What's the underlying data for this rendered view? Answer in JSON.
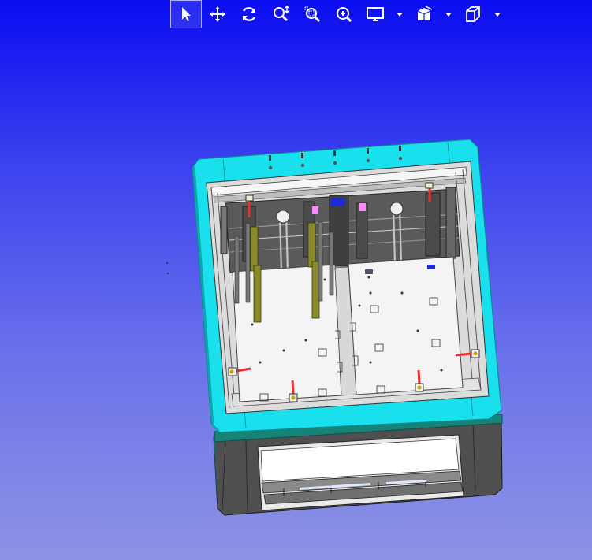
{
  "app": {
    "type": "cad-3d-viewer"
  },
  "toolbar": {
    "tools": [
      {
        "id": "select",
        "icon": "cursor-arrow-icon",
        "active": true
      },
      {
        "id": "pan",
        "icon": "pan-move-icon",
        "active": false
      },
      {
        "id": "rotate",
        "icon": "rotate-icon",
        "active": false
      },
      {
        "id": "zoom",
        "icon": "zoom-icon",
        "active": false
      },
      {
        "id": "zoom-window",
        "icon": "zoom-window-icon",
        "active": false
      },
      {
        "id": "zoom-fit",
        "icon": "zoom-fit-icon",
        "active": false
      },
      {
        "id": "display-mode",
        "icon": "monitor-icon",
        "dropdown": true
      },
      {
        "id": "section",
        "icon": "section-view-icon",
        "dropdown": true
      },
      {
        "id": "view-orientation",
        "icon": "cube-view-icon",
        "dropdown": true
      }
    ]
  },
  "colors": {
    "background_top": "#0a0df0",
    "background_bottom": "#8d93e4",
    "frame_cyan": "#19e0ec",
    "frame_teal": "#17807a",
    "base_dark": "#505050",
    "actuator_olive": "#8b8a2a",
    "clamp_red": "#e83030",
    "plate_white": "#f4f4f4"
  }
}
